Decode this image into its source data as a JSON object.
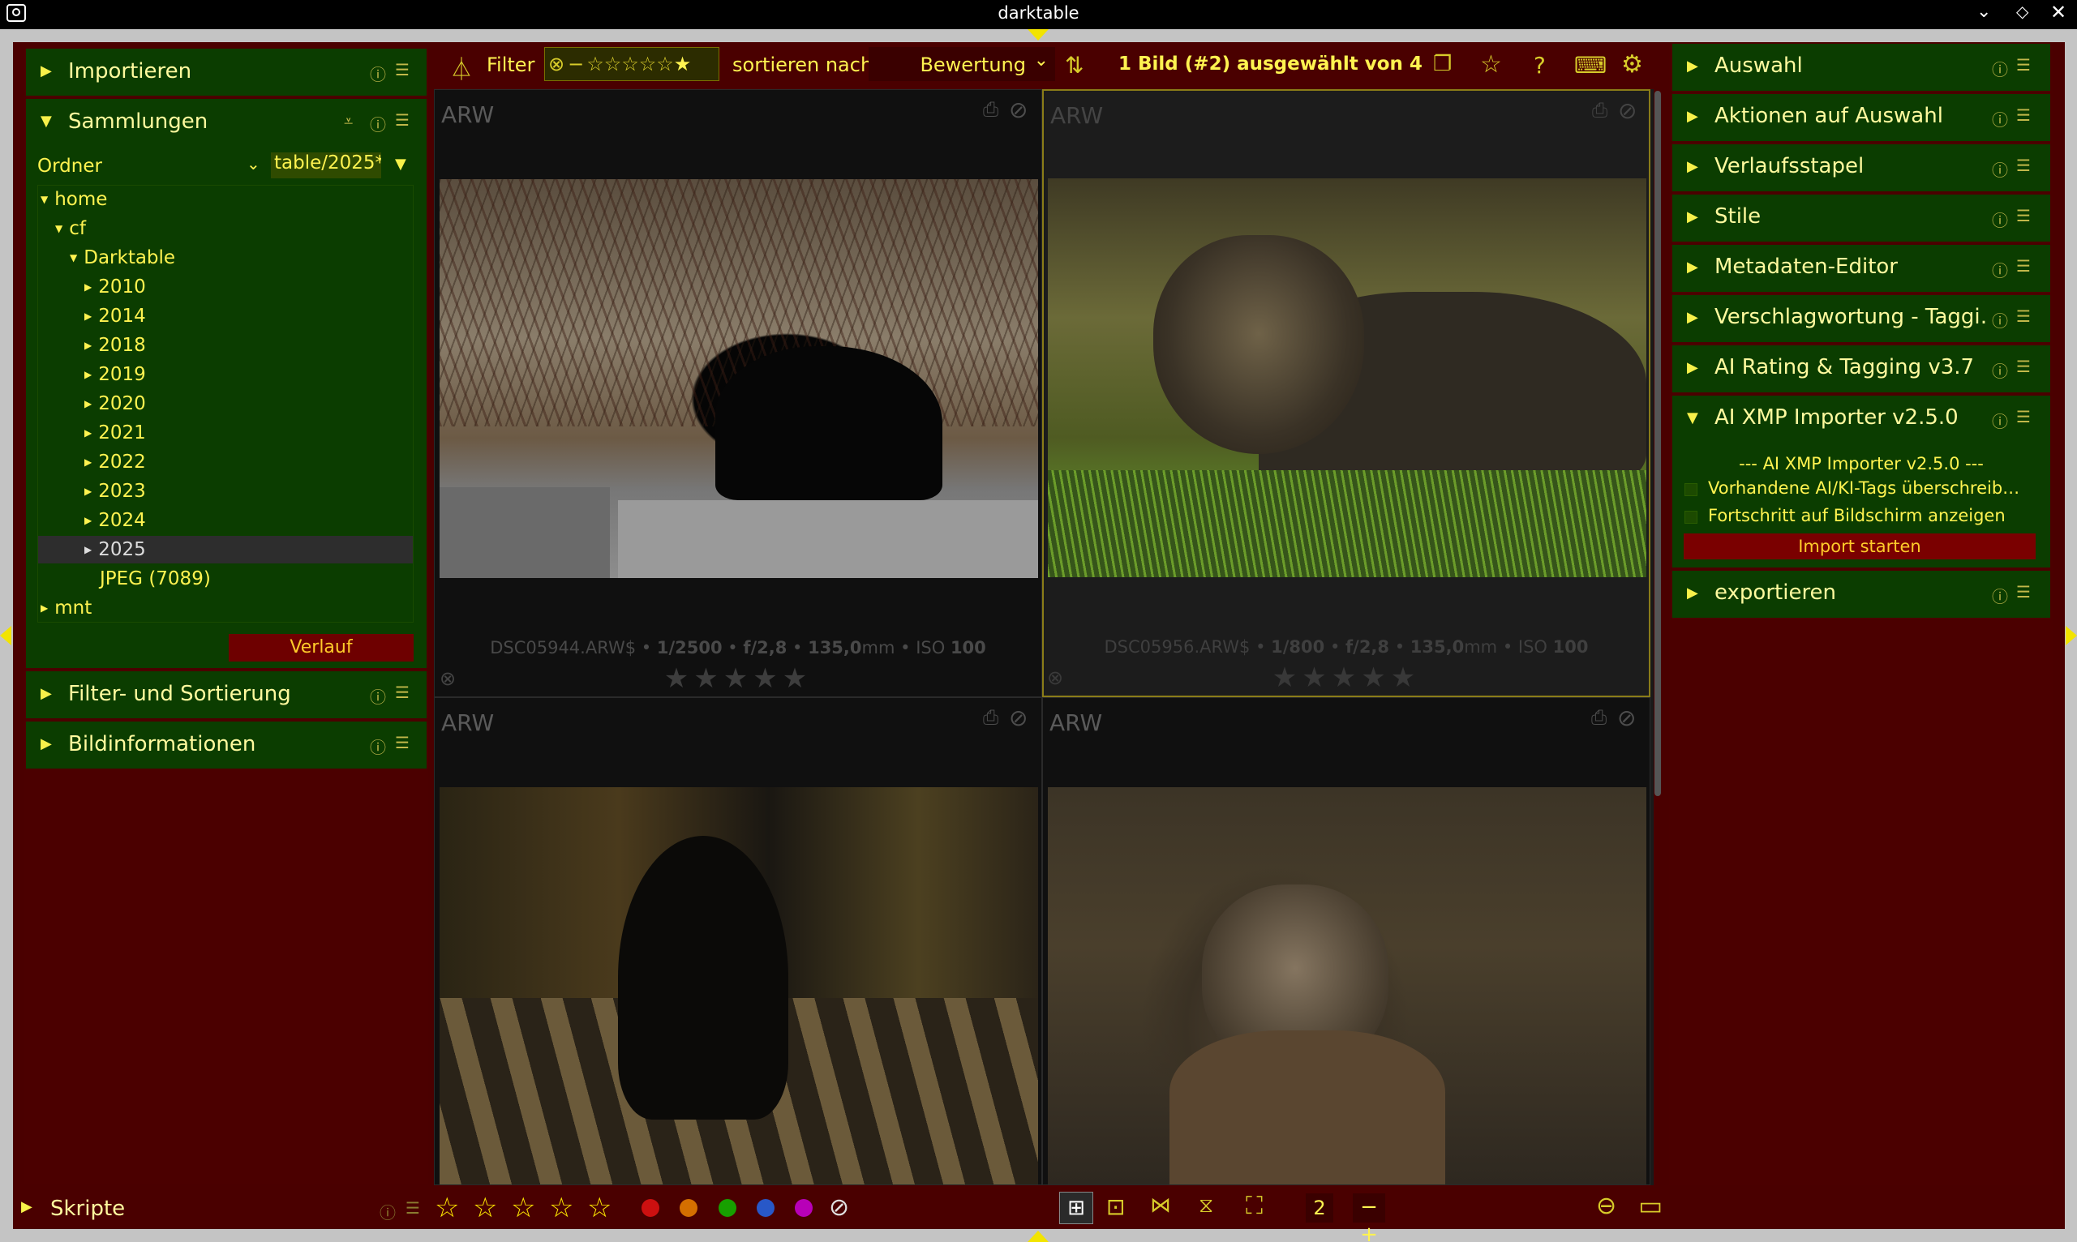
{
  "window": {
    "title": "darktable"
  },
  "left_panel": {
    "import": {
      "label": "Importieren"
    },
    "collections": {
      "label": "Sammlungen",
      "filter_type": "Ordner",
      "filter_value": "table/2025*",
      "tree": [
        {
          "label": "home",
          "level": 0
        },
        {
          "label": "cf",
          "level": 1
        },
        {
          "label": "Darktable",
          "level": 2
        },
        {
          "label": "2010",
          "level": 3
        },
        {
          "label": "2014",
          "level": 3
        },
        {
          "label": "2018",
          "level": 3
        },
        {
          "label": "2019",
          "level": 3
        },
        {
          "label": "2020",
          "level": 3
        },
        {
          "label": "2021",
          "level": 3
        },
        {
          "label": "2022",
          "level": 3
        },
        {
          "label": "2023",
          "level": 3
        },
        {
          "label": "2024",
          "level": 3
        },
        {
          "label": "2025",
          "level": 3,
          "selected": true
        },
        {
          "label": "JPEG (7089)",
          "level": 3,
          "leaf": true
        },
        {
          "label": "mnt",
          "level": 0
        }
      ],
      "history_button": "Verlauf"
    },
    "filter_sort": {
      "label": "Filter- und Sortierung"
    },
    "image_info": {
      "label": "Bildinformationen"
    },
    "scripts": {
      "label": "Skripte"
    }
  },
  "toolbar": {
    "filter_label": "Filter",
    "sort_label": "sortieren nach",
    "sort_value": "Bewertung",
    "selection_status": "1 Bild (#2) ausgewählt von 4"
  },
  "thumbnails": [
    {
      "format": "ARW",
      "filename": "DSC05944.ARW$",
      "shutter": "1/2500",
      "aperture": "f/2,8",
      "focal": "135,0",
      "focal_unit": "mm",
      "iso_label": "ISO",
      "iso": "100",
      "stars": "★★★★★"
    },
    {
      "format": "ARW",
      "filename": "DSC05956.ARW$",
      "shutter": "1/800",
      "aperture": "f/2,8",
      "focal": "135,0",
      "focal_unit": "mm",
      "iso_label": "ISO",
      "iso": "100",
      "stars": "★★★★★"
    },
    {
      "format": "ARW"
    },
    {
      "format": "ARW"
    }
  ],
  "right_panel": {
    "modules": [
      {
        "label": "Auswahl"
      },
      {
        "label": "Aktionen auf Auswahl"
      },
      {
        "label": "Verlaufsstapel"
      },
      {
        "label": "Stile"
      },
      {
        "label": "Metadaten-Editor"
      },
      {
        "label": "Verschlagwortung - Taggi…"
      },
      {
        "label": "AI Rating & Tagging v3.7"
      },
      {
        "label": "AI XMP Importer v2.5.0"
      },
      {
        "label": "exportieren"
      }
    ],
    "xmp_importer": {
      "header": "--- AI XMP Importer v2.5.0 ---",
      "opt1": "Vorhandene AI/KI-Tags überschreib…",
      "opt2": "Fortschritt auf Bildschirm anzeigen",
      "start_button": "Import starten"
    }
  },
  "bottom_bar": {
    "zoom_value": "2",
    "zoom_controls": "−+"
  },
  "colors": {
    "panel_bg": "#4a0000",
    "module_bg": "#0b3d00",
    "accent_yellow": "#fff350",
    "label_red": "#cc1010",
    "label_orange": "#d46f00",
    "label_green": "#17a000",
    "label_blue": "#2858c8",
    "label_purple": "#b800b8"
  }
}
